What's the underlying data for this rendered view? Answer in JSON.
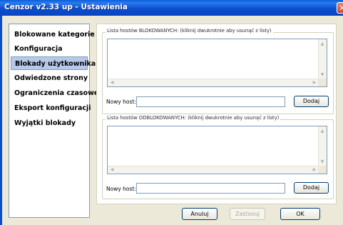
{
  "window": {
    "title": "Cenzor v2.33 up - Ustawienia",
    "close_glyph": "✕"
  },
  "sidebar": {
    "items": [
      {
        "label": "Blokowane kategorie"
      },
      {
        "label": "Konfiguracja"
      },
      {
        "label": "Blokady użytkownika",
        "selected": true
      },
      {
        "label": "Odwiedzone strony"
      },
      {
        "label": "Ograniczenia czasowe"
      },
      {
        "label": "Eksport konfiguracji"
      },
      {
        "label": "Wyjątki blokady"
      }
    ]
  },
  "blocked": {
    "group_label": "Lista hostów BLOKOWANYCH: (kliknij dwukrotnie aby usunąć z listy)",
    "host_label": "Nowy host:",
    "host_value": "",
    "add_label": "Dodaj"
  },
  "unblocked": {
    "group_label": "Lista hostów ODBLOKOWANYCH: (kliknij dwukrotnie aby usunąć z listy)",
    "host_label": "Nowy host:",
    "host_value": "",
    "add_label": "Dodaj"
  },
  "footer": {
    "cancel_label": "Anuluj",
    "apply_label": "Zastosuj",
    "ok_label": "OK"
  },
  "colors": {
    "titlebar": "#0b4fd0",
    "window_bg": "#ece9d8",
    "selected_item": "#b8c8e8"
  }
}
